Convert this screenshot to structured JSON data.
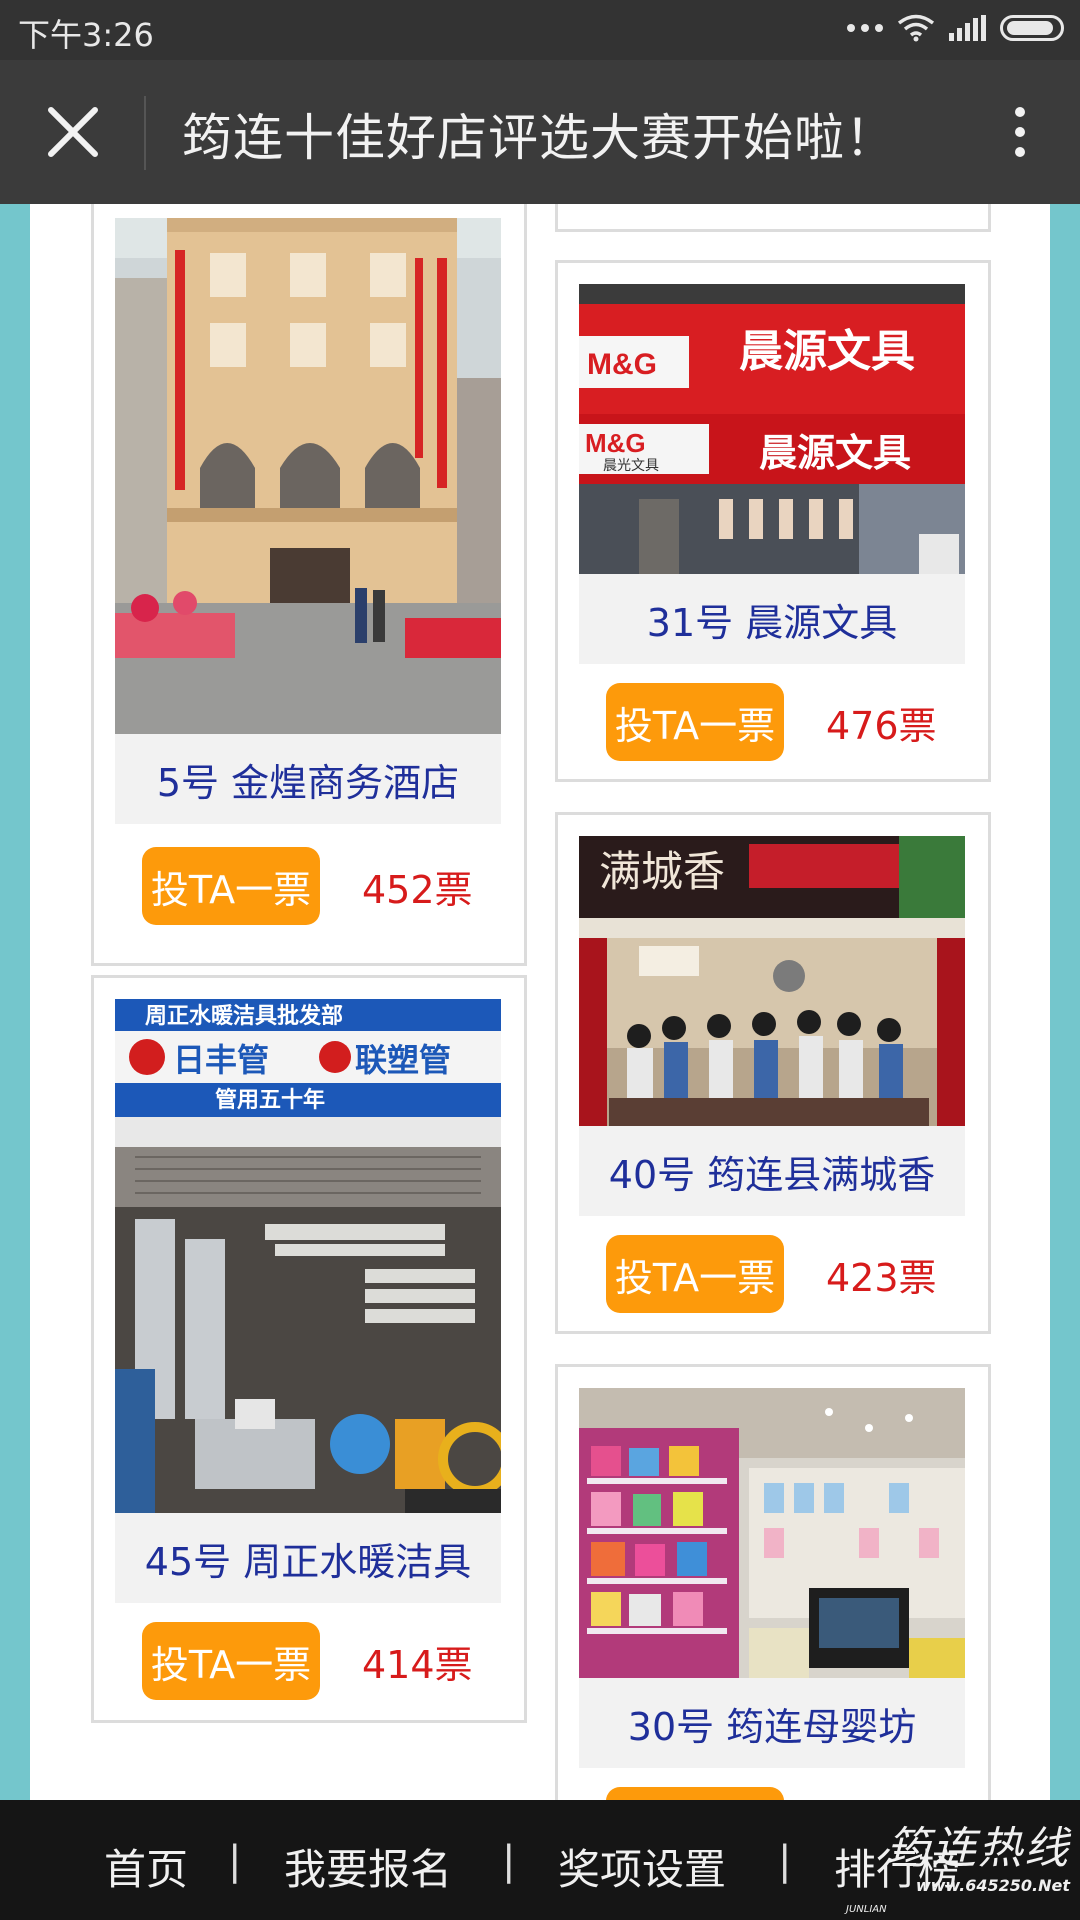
{
  "status_bar": {
    "time": "下午3:26"
  },
  "title_bar": {
    "title": "筠连十佳好店评选大赛开始啦！"
  },
  "vote_button_label": "投TA一票",
  "cards": [
    {
      "name": "5号 金煌商务酒店",
      "votes": "452票",
      "photo_icon": "hotel-photo"
    },
    {
      "name": "31号 晨源文具",
      "votes": "476票",
      "photo_icon": "stationery-shop-photo",
      "sign_text": "晨源文具",
      "logo_text": "M&G",
      "logo_sub": "晨光文具"
    },
    {
      "name": "40号 筠连县满城香",
      "votes": "423票",
      "photo_icon": "restaurant-photo",
      "sign_text": "满城香"
    },
    {
      "name": "45号 周正水暖洁具",
      "votes": "414票",
      "photo_icon": "plumbing-shop-photo",
      "sign_line1": "周正水暖洁具批发部",
      "sign_line2a": "日丰管",
      "sign_line2b": "联塑管",
      "sign_line3": "管用五十年"
    },
    {
      "name": "30号 筠连母婴坊",
      "votes": "",
      "photo_icon": "baby-store-photo"
    }
  ],
  "bottom_nav": {
    "items": [
      "首页",
      "我要报名",
      "奖项设置",
      "排行榜"
    ],
    "separator": "|"
  },
  "watermark": {
    "brand": "筠连热线",
    "url": "www.645250.Net",
    "en": "JUNLIAN"
  },
  "colors": {
    "vote_button": "#fd9a0b",
    "vote_count": "#d71b1b",
    "store_name": "#1f2f9a",
    "page_background": "#74c6cc"
  }
}
